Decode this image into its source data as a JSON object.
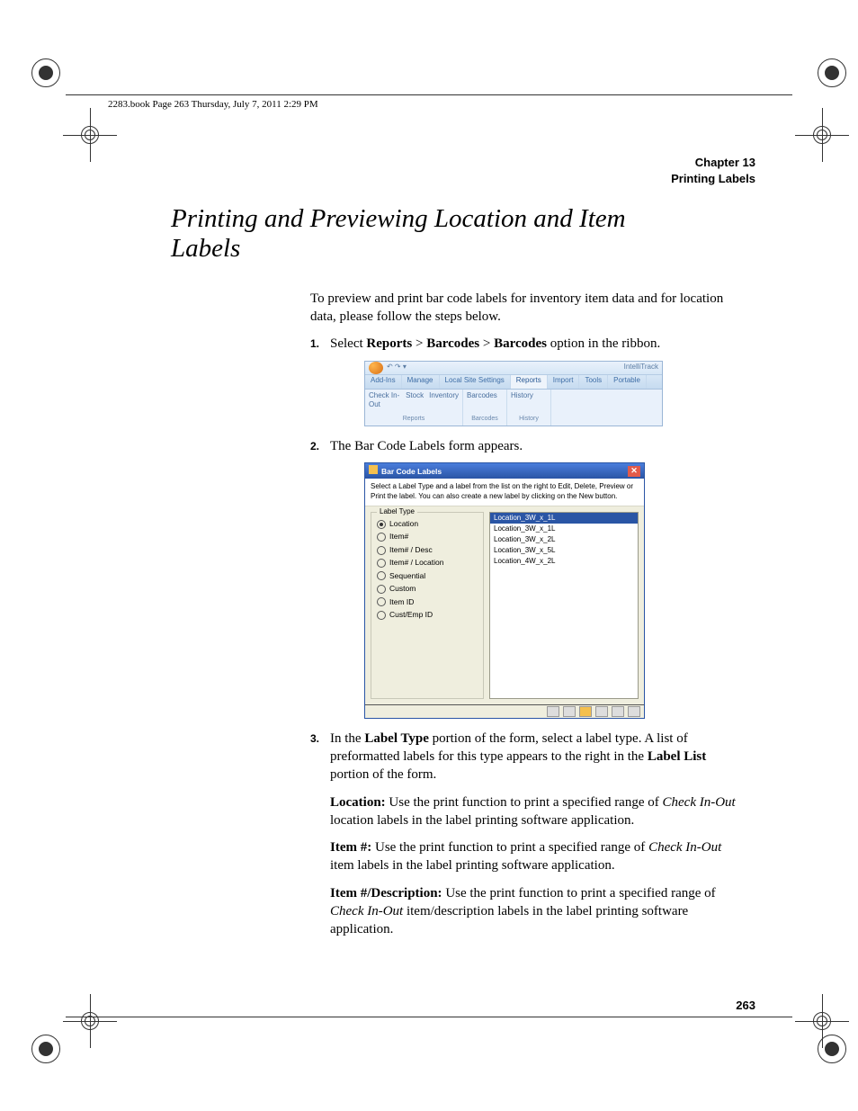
{
  "running_head": "2283.book  Page 263  Thursday, July 7, 2011  2:29 PM",
  "chapter": {
    "line1": "Chapter 13",
    "line2": "Printing Labels"
  },
  "section_title": "Printing and Previewing Location and Item Labels",
  "intro": "To preview and print bar code labels for inventory item data and for location data, please follow the steps below.",
  "step1": {
    "num": "1.",
    "pre": "Select ",
    "reports": "Reports",
    "gt1": " > ",
    "barcodes1": "Barcodes",
    "gt2": " > ",
    "barcodes2": "Barcodes",
    "post": " option in the ribbon."
  },
  "ribbon": {
    "app_name": "IntelliTrack",
    "qat_icons": "↶   ↷   ▾",
    "tabs": [
      "Add-Ins",
      "Manage",
      "Local Site Settings",
      "Reports",
      "Import",
      "Tools",
      "Portable"
    ],
    "active_tab_index": 3,
    "group1_items": [
      "Check In-Out",
      "Stock",
      "Inventory"
    ],
    "group1_label": "Reports",
    "group2_items": [
      "Barcodes",
      "History"
    ],
    "group2_labels": [
      "Barcodes",
      "History"
    ]
  },
  "step2": {
    "num": "2.",
    "text": "The Bar Code Labels form appears."
  },
  "dialog": {
    "title": "Bar Code Labels",
    "desc": "Select a Label Type and a label from the list on the right to Edit, Delete, Preview or Print the label. You can also create a new label by clicking on the New button.",
    "group_label": "Label Type",
    "radios": [
      "Location",
      "Item#",
      "Item# / Desc",
      "Item# / Location",
      "Sequential",
      "Custom",
      "Item ID",
      "Cust/Emp ID"
    ],
    "selected_radio_index": 0,
    "list": [
      "Location_3W_x_1L",
      "Location_3W_x_1L",
      "Location_3W_x_2L",
      "Location_3W_x_5L",
      "Location_4W_x_2L"
    ],
    "selected_list_index": 0
  },
  "step3": {
    "num": "3.",
    "t1": "In the ",
    "b1": "Label Type",
    "t2": " portion of the form, select a label type. A list of preformatted labels for this type appears to the right in the ",
    "b2": "Label List",
    "t3": " portion of the form."
  },
  "loc": {
    "b": "Location:",
    "t1": " Use the print function to print a specified range of ",
    "i": "Check In-Out",
    "t2": " location labels in the label printing software application."
  },
  "item": {
    "b": "Item #:",
    "t1": " Use the print function to print a specified range of ",
    "i": "Check In-Out",
    "t2": " item labels in the label printing software application."
  },
  "itemdesc": {
    "b": "Item #/Description:",
    "t1": " Use the print function to print a specified range of ",
    "i": "Check In-Out",
    "t2": " item/description labels in the label printing software application."
  },
  "page_number": "263"
}
